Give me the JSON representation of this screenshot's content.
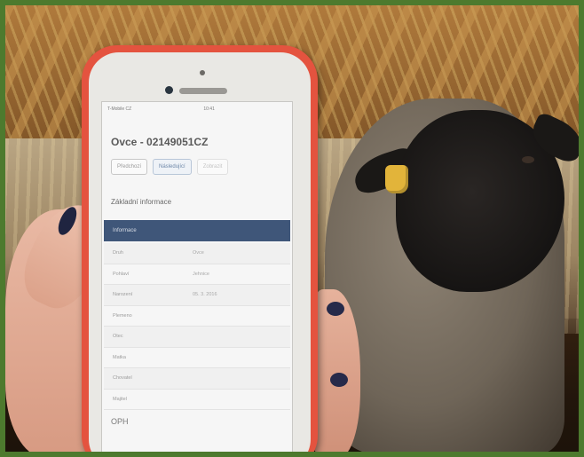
{
  "photo": {
    "subject": "",
    "colors": {
      "frame": "#4d7a2e",
      "phone_case": "#e4533f",
      "header_bar": "#3f5679",
      "ear_tag": "#e2b43a"
    }
  },
  "phone_screen": {
    "status": {
      "carrier": "T-Mobile CZ",
      "time": "10:41",
      "url": "",
      "battery": ""
    },
    "title": "Ovce - 02149051CZ",
    "tabs": [
      {
        "label": "Předchozí",
        "state": "normal"
      },
      {
        "label": "Následující",
        "state": "active"
      },
      {
        "label": "Zobrazit",
        "state": "disabled"
      }
    ],
    "section_title": "Základní informace",
    "info_header": "Informace",
    "rows": [
      {
        "label": "Druh",
        "value": "Ovce"
      },
      {
        "label": "Pohlaví",
        "value": "Jehnice"
      },
      {
        "label": "Narození",
        "value": "05. 3. 2016"
      },
      {
        "label": "Plemeno",
        "value": ""
      },
      {
        "label": "Otec",
        "value": ""
      },
      {
        "label": "Matka",
        "value": ""
      },
      {
        "label": "Chovatel",
        "value": ""
      },
      {
        "label": "Majitel",
        "value": ""
      }
    ],
    "footer_section": "OPH"
  }
}
